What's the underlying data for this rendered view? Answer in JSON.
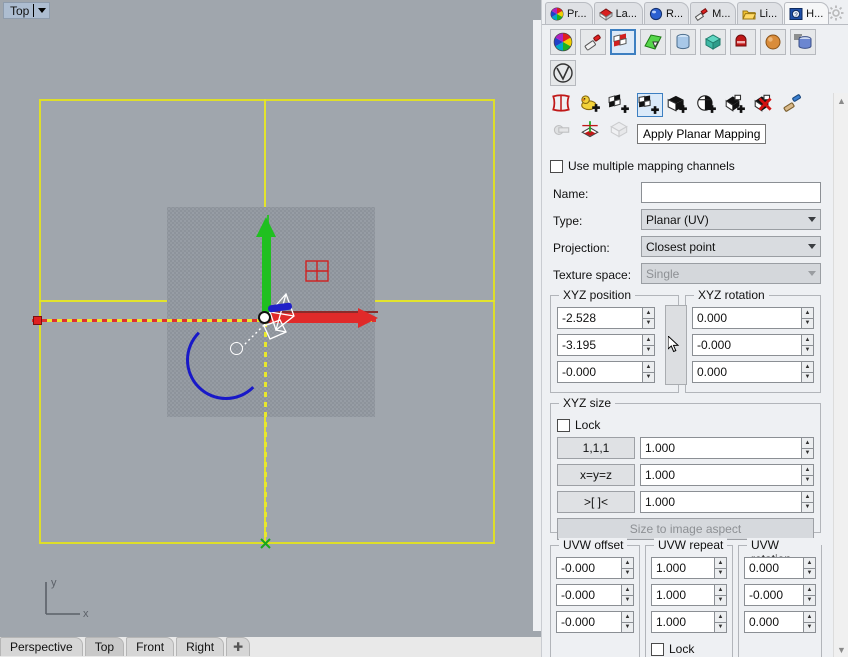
{
  "viewport": {
    "title": "Top",
    "dropdown_icon": "chevron-down-icon",
    "axis_x_label": "x",
    "axis_y_label": "y",
    "tabs": [
      {
        "label": "Perspective",
        "active": false
      },
      {
        "label": "Top",
        "active": true
      },
      {
        "label": "Front",
        "active": false
      },
      {
        "label": "Right",
        "active": false
      },
      {
        "label": "+",
        "active": false
      }
    ]
  },
  "panel": {
    "tabs": [
      {
        "label": "Pr...",
        "icon": "color-wheel-icon",
        "active": false
      },
      {
        "label": "La...",
        "icon": "layers-icon",
        "active": false
      },
      {
        "label": "R...",
        "icon": "render-sphere-icon",
        "active": false
      },
      {
        "label": "M...",
        "icon": "material-brush-icon",
        "active": false
      },
      {
        "label": "Li...",
        "icon": "folder-library-icon",
        "active": false
      },
      {
        "label": "H...",
        "icon": "help-icon",
        "active": true
      }
    ],
    "gear_icon": "gear-icon",
    "material_icons": [
      "color-wheel-icon",
      "brush-icon",
      "checker-plane-icon",
      "green-plane-icon",
      "glass-cylinder-icon",
      "teal-box-icon",
      "red-mailbox-icon",
      "orange-sphere-icon",
      "blue-cylinder-icon",
      "vray-icon"
    ],
    "tool_icons_row1": [
      "surface-mapping-icon",
      "duck-add-icon",
      "checker-plane-add-icon",
      "checker-planar-add-icon",
      "checker-box-add-icon",
      "checker-sphere-add-icon",
      "checker-cluster-add-icon",
      "checker-remove-icon",
      "paintbrush-icon"
    ],
    "tool_icons_row2": [
      "cylinder-map-icon",
      "uv-editor-icon",
      "unwrap-icon"
    ],
    "selected_tool": "checker-planar-add-icon",
    "tooltip": "Apply Planar Mapping",
    "scrollbar": {
      "up_icon": "chevron-up-icon",
      "down_icon": "chevron-down-icon"
    },
    "use_multiple_channels": {
      "label": "Use multiple mapping channels",
      "checked": false
    },
    "fields": {
      "name_label": "Name:",
      "name_value": "",
      "type_label": "Type:",
      "type_value": "Planar (UV)",
      "projection_label": "Projection:",
      "projection_value": "Closest point",
      "texture_space_label": "Texture space:",
      "texture_space_value": "Single",
      "texture_space_disabled": true
    },
    "xyz_position": {
      "title": "XYZ position",
      "values": [
        "-2.528",
        "-3.195",
        "-0.000"
      ]
    },
    "xyz_rotation": {
      "title": "XYZ rotation",
      "values": [
        "0.000",
        "-0.000",
        "0.000"
      ]
    },
    "xyz_size": {
      "title": "XYZ size",
      "lock_label": "Lock",
      "lock_checked": false,
      "buttons": [
        "1,1,1",
        "x=y=z",
        ">[ ]<"
      ],
      "values": [
        "1.000",
        "1.000",
        "1.000"
      ],
      "size_to_aspect": "Size to image aspect",
      "size_to_aspect_disabled": true
    },
    "uvw_offset": {
      "title": "UVW offset",
      "values": [
        "-0.000",
        "-0.000",
        "-0.000"
      ]
    },
    "uvw_repeat": {
      "title": "UVW repeat",
      "values": [
        "1.000",
        "1.000",
        "1.000"
      ],
      "lock_label": "Lock",
      "lock_checked": false
    },
    "uvw_rotation": {
      "title": "UVW rotation",
      "values": [
        "0.000",
        "-0.000",
        "0.000"
      ]
    }
  },
  "colors": {
    "viewport_bg": "#a0a6ad",
    "cplane_yellow": "#dede2a",
    "axis_red": "#e02a2a",
    "axis_green": "#20c020",
    "axis_blue": "#2020c8",
    "arc_blue": "#1818c8",
    "panel_bg": "#eef0f3",
    "select_blue": "#3d7fc1"
  }
}
